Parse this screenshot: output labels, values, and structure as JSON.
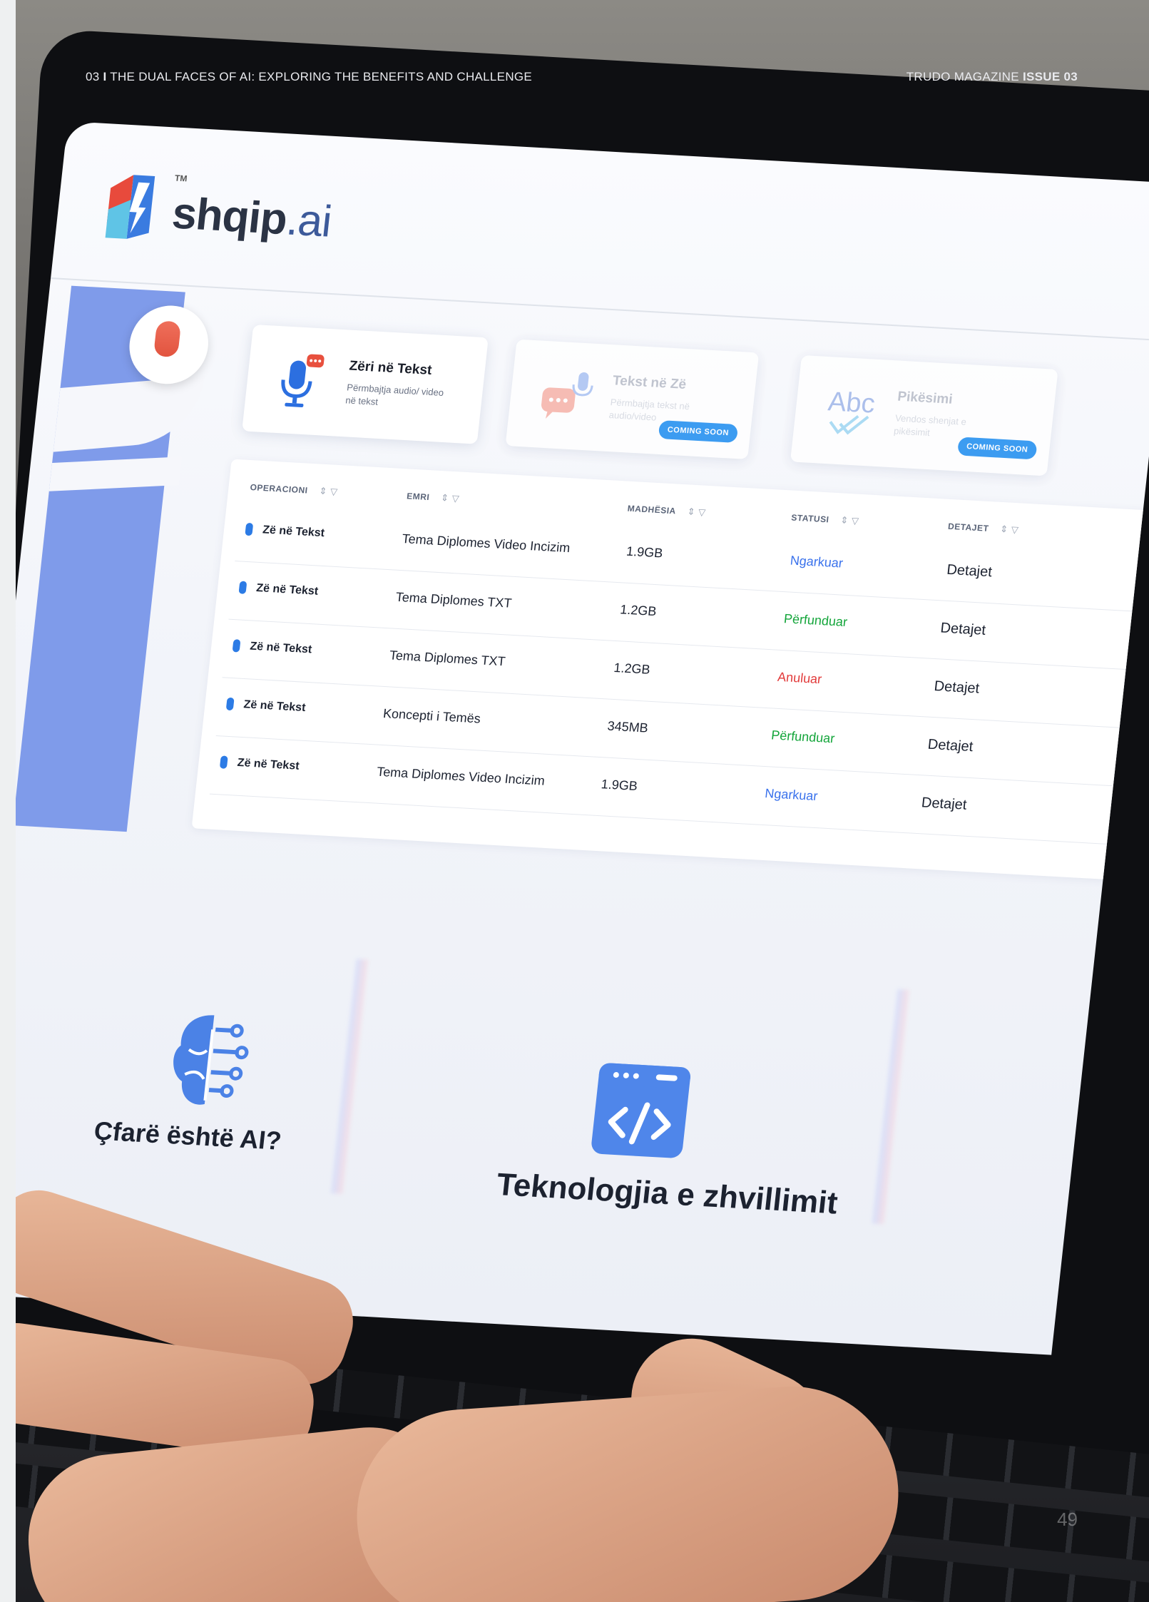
{
  "magazine_header": {
    "page_prefix": "03",
    "separator": "I",
    "article_title": "THE DUAL FACES OF AI: EXPLORING THE BENEFITS AND CHALLENGE",
    "magazine_name": "TRUDO MAGAZINE",
    "issue_label": "ISSUE 03"
  },
  "page_number": "49",
  "app": {
    "logo_tm": "TM",
    "logo_main": "shqip",
    "logo_suffix": ".ai"
  },
  "cards": [
    {
      "title": "Zëri në Tekst",
      "subtitle": "Përmbajtja audio/ video në tekst",
      "badge": ""
    },
    {
      "title": "Tekst në Zë",
      "subtitle": "Përmbajtja tekst në audio/video",
      "badge": "COMING SOON"
    },
    {
      "title": "Pikësimi",
      "subtitle": "Vendos shenjat e pikësimit",
      "badge": "COMING SOON"
    }
  ],
  "card3_icon_text": "Abc",
  "table": {
    "headers": [
      "OPERACIONI",
      "EMRI",
      "MADHËSIA",
      "STATUSI",
      "DETAJET"
    ],
    "rows": [
      {
        "op": "Zë në Tekst",
        "name": "Tema Diplomes Video Incizim",
        "size": "1.9GB",
        "status": "Ngarkuar",
        "details": "Detajet"
      },
      {
        "op": "Zë në Tekst",
        "name": "Tema Diplomes TXT",
        "size": "1.2GB",
        "status": "Përfunduar",
        "details": "Detajet"
      },
      {
        "op": "Zë në Tekst",
        "name": "Tema Diplomes TXT",
        "size": "1.2GB",
        "status": "Anuluar",
        "details": "Detajet"
      },
      {
        "op": "Zë në Tekst",
        "name": "Koncepti i Temës",
        "size": "345MB",
        "status": "Përfunduar",
        "details": "Detajet"
      },
      {
        "op": "Zë në Tekst",
        "name": "Tema Diplomes Video Incizim",
        "size": "1.9GB",
        "status": "Ngarkuar",
        "details": "Detajet"
      }
    ]
  },
  "features": [
    {
      "title": "Çfarë është AI?"
    },
    {
      "title": "Teknologjia e zhvillimit"
    }
  ],
  "colors": {
    "accent_blue": "#1c8cf0",
    "sidebar_blue": "#7f9bea",
    "status_loaded": "#3a72ec",
    "status_done": "#13a53a",
    "status_cancelled": "#e23a3a"
  }
}
